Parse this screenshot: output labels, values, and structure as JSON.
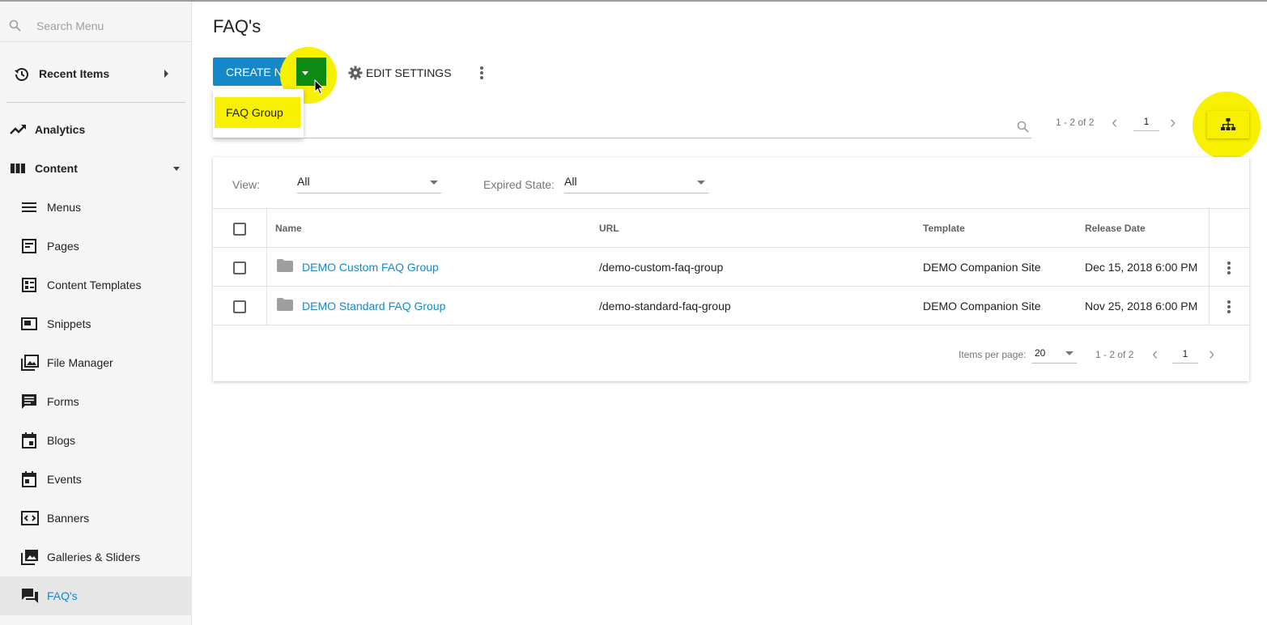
{
  "sidebar": {
    "search_placeholder": "Search Menu",
    "recent_label": "Recent Items",
    "analytics_label": "Analytics",
    "content_label": "Content",
    "items": [
      {
        "label": "Menus"
      },
      {
        "label": "Pages"
      },
      {
        "label": "Content Templates"
      },
      {
        "label": "Snippets"
      },
      {
        "label": "File Manager"
      },
      {
        "label": "Forms"
      },
      {
        "label": "Blogs"
      },
      {
        "label": "Events"
      },
      {
        "label": "Banners"
      },
      {
        "label": "Galleries & Sliders"
      },
      {
        "label": "FAQ's"
      }
    ],
    "active_item": "FAQ's"
  },
  "header": {
    "title": "FAQ's",
    "create_label": "CREATE NEW",
    "edit_settings_label": "EDIT SETTINGS"
  },
  "create_menu": {
    "options": [
      "FAQ Group"
    ]
  },
  "top_pager": {
    "range": "1 - 2 of 2",
    "page": "1"
  },
  "filters": {
    "view_label": "View:",
    "view_value": "All",
    "expired_label": "Expired State:",
    "expired_value": "All"
  },
  "table": {
    "columns": [
      "Name",
      "URL",
      "Template",
      "Release Date"
    ],
    "rows": [
      {
        "name": "DEMO Custom FAQ Group",
        "url": "/demo-custom-faq-group",
        "template": "DEMO Companion Site",
        "release": "Dec 15, 2018 6:00 PM"
      },
      {
        "name": "DEMO Standard FAQ Group",
        "url": "/demo-standard-faq-group",
        "template": "DEMO Companion Site",
        "release": "Nov 25, 2018 6:00 PM"
      }
    ]
  },
  "footer": {
    "items_per_page_label": "Items per page:",
    "items_per_page_value": "20",
    "range": "1 - 2 of 2",
    "page": "1"
  },
  "colors": {
    "accent": "#1589c8",
    "highlight": "#f7f000",
    "caret_box": "#0d8a12"
  }
}
